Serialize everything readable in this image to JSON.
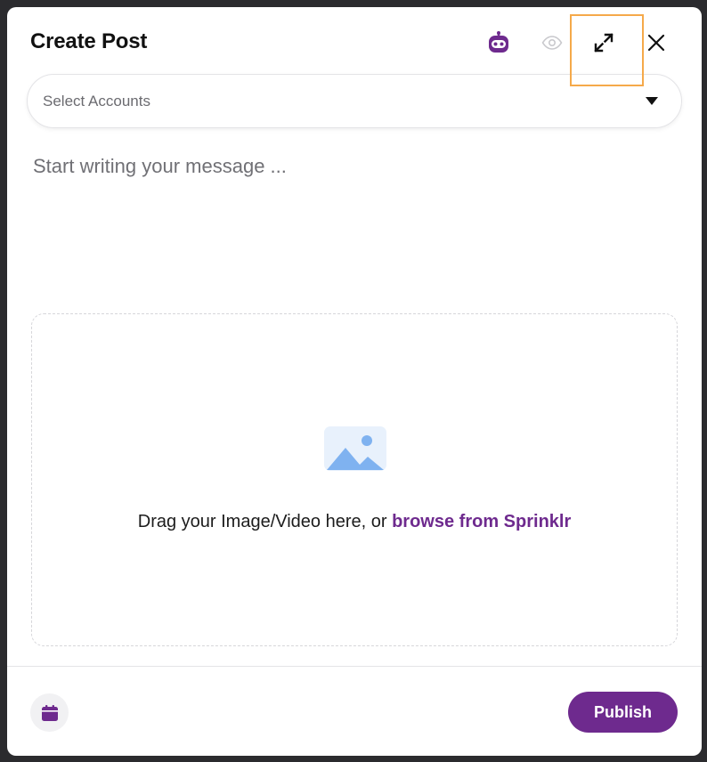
{
  "modal": {
    "title": "Create Post"
  },
  "header_icons": {
    "bot": "bot-icon",
    "preview": "eye-icon",
    "expand": "expand-icon",
    "close": "close-icon"
  },
  "accounts": {
    "placeholder": "Select Accounts"
  },
  "composer": {
    "placeholder": "Start writing your message ..."
  },
  "dropzone": {
    "text": "Drag your Image/Video here, or ",
    "link": "browse from Sprinklr",
    "icon": "image-icon"
  },
  "footer": {
    "schedule_icon": "calendar-icon",
    "publish_label": "Publish"
  },
  "colors": {
    "brand": "#6e2a8e",
    "highlight": "#f5a94a",
    "image_icon": "#7fb2f0"
  }
}
